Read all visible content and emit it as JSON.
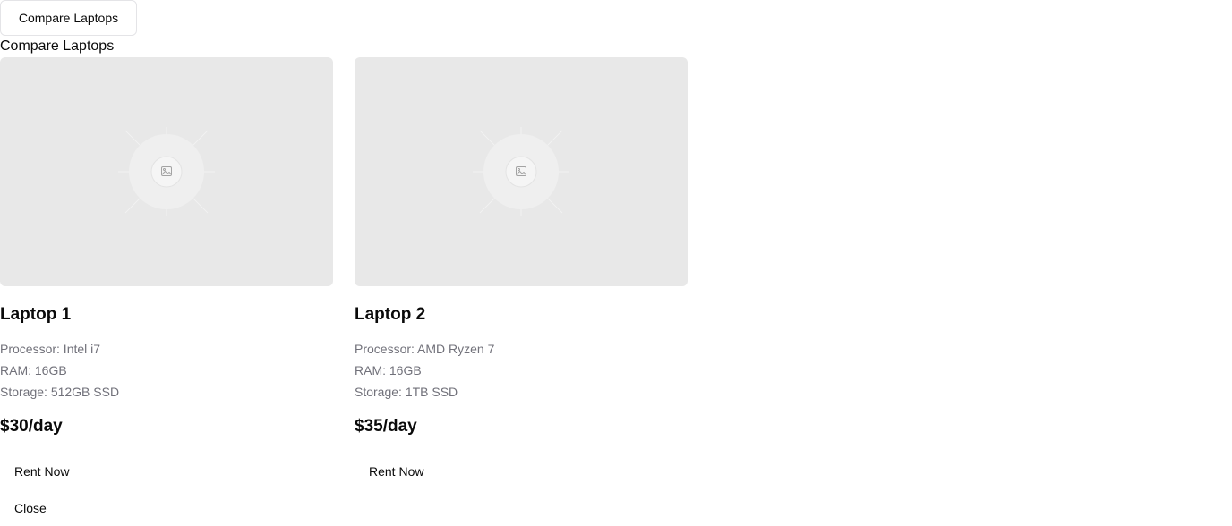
{
  "trigger": {
    "label": "Compare Laptops"
  },
  "dialog": {
    "title": "Compare Laptops",
    "close_label": "Close"
  },
  "laptops": [
    {
      "name": "Laptop 1",
      "specs": [
        "Processor: Intel i7",
        "RAM: 16GB",
        "Storage: 512GB SSD"
      ],
      "price": "$30/day",
      "action_label": "Rent Now",
      "image_icon": "image-placeholder-icon"
    },
    {
      "name": "Laptop 2",
      "specs": [
        "Processor: AMD Ryzen 7",
        "RAM: 16GB",
        "Storage: 1TB SSD"
      ],
      "price": "$35/day",
      "action_label": "Rent Now",
      "image_icon": "image-placeholder-icon"
    }
  ],
  "colors": {
    "placeholder_bg": "#e8e8e8",
    "muted_text": "#71717a",
    "border": "#e4e4e7"
  }
}
